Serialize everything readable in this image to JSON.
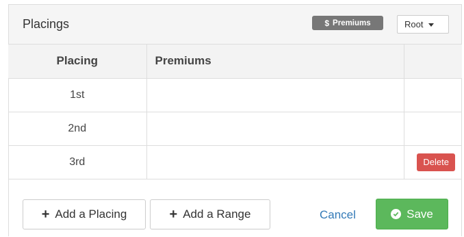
{
  "panel": {
    "title": "Placings",
    "premiums_label": {
      "icon": "dollar-icon",
      "glyph": "$",
      "text": "Premiums"
    },
    "root_select": {
      "selected": "Root",
      "icon": "caret-down-icon"
    }
  },
  "table": {
    "headers": [
      "Placing",
      "Premiums",
      ""
    ],
    "rows": [
      {
        "placing": "1st",
        "premiums": "",
        "action": ""
      },
      {
        "placing": "2nd",
        "premiums": "",
        "action": ""
      },
      {
        "placing": "3rd",
        "premiums": "",
        "action": "Delete"
      }
    ]
  },
  "footer": {
    "add_placing": "Add a Placing",
    "add_range": "Add a Range",
    "cancel": "Cancel",
    "save": "Save",
    "plus_glyph": "+"
  },
  "colors": {
    "delete": "#d9534f",
    "save": "#5cb85c",
    "link": "#337ab7",
    "label": "#777777"
  }
}
